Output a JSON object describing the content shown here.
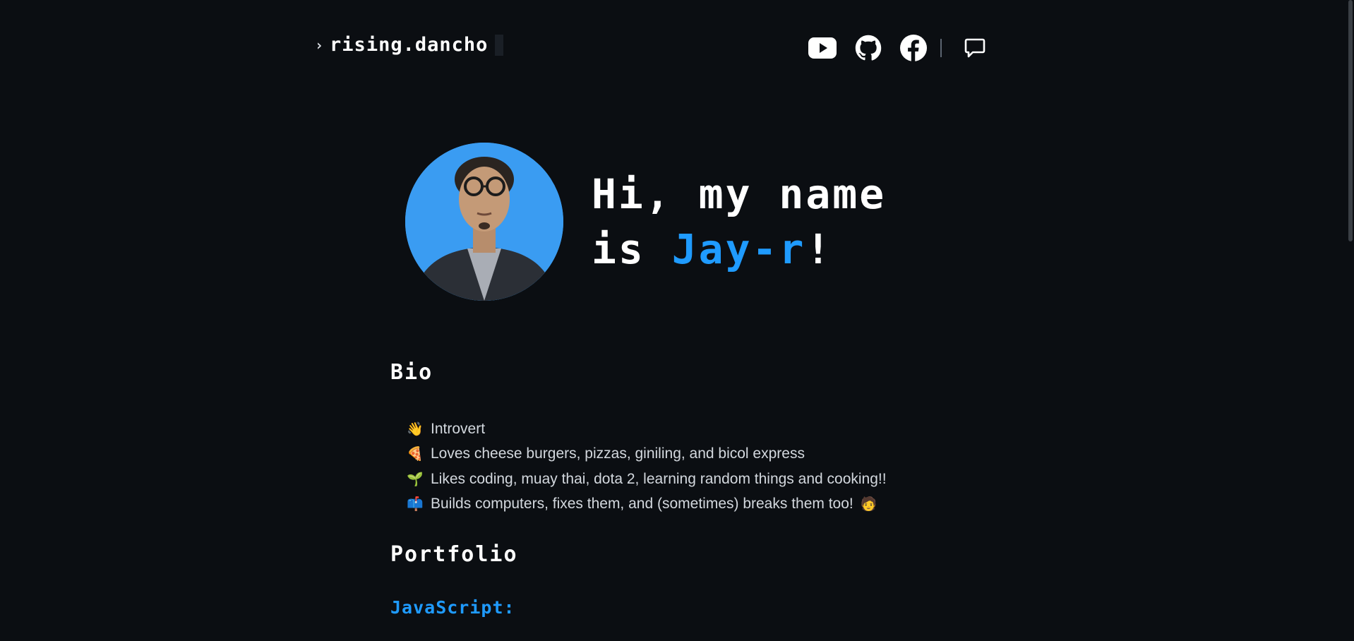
{
  "header": {
    "prompt_symbol": "›",
    "logo_text": "rising.dancho",
    "nav": [
      {
        "name": "youtube-icon",
        "icon": "youtube"
      },
      {
        "name": "github-icon",
        "icon": "github"
      },
      {
        "name": "facebook-icon",
        "icon": "facebook"
      },
      {
        "name": "chat-icon",
        "icon": "chat-bubble"
      }
    ]
  },
  "hero": {
    "title_part1": "Hi, my name",
    "title_part2": "is ",
    "name": "Jay-r",
    "exclamation": "!",
    "avatar_icon": "profile-photo"
  },
  "bio": {
    "title": "Bio",
    "items": [
      {
        "emoji": "👋",
        "text": "Introvert",
        "trailing_emoji": ""
      },
      {
        "emoji": "🍕",
        "text": "Loves cheese burgers, pizzas, giniling, and bicol express",
        "trailing_emoji": ""
      },
      {
        "emoji": "🌱",
        "text": "Likes coding, muay thai, dota 2, learning random things and cooking!!",
        "trailing_emoji": ""
      },
      {
        "emoji": "📫",
        "text": "Builds computers, fixes them, and (sometimes) breaks them too!",
        "trailing_emoji": "🧑"
      }
    ]
  },
  "portfolio": {
    "title": "Portfolio",
    "subheading": "JavaScript:"
  },
  "colors": {
    "background": "#0b0e12",
    "accent": "#1f9bff",
    "text": "#ffffff",
    "muted_text": "#d3d8de"
  }
}
